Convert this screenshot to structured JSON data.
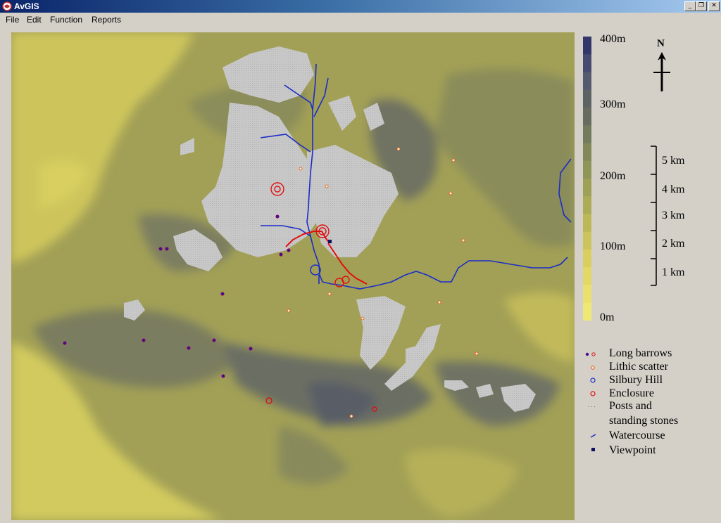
{
  "window": {
    "title": "AvGIS",
    "buttons": {
      "minimize": "_",
      "restore": "❐",
      "close": "✕"
    }
  },
  "menu": {
    "items": [
      "File",
      "Edit",
      "Function",
      "Reports"
    ]
  },
  "elevation_legend": {
    "labels": [
      "400m",
      "300m",
      "200m",
      "100m",
      "0m"
    ],
    "colors": [
      "#33366a",
      "#464a70",
      "#565a6e",
      "#5d6264",
      "#686c60",
      "#747a5c",
      "#82885a",
      "#8f9458",
      "#9ea056",
      "#adac56",
      "#bcb858",
      "#cbc45c",
      "#d8cf60",
      "#e2d865",
      "#eae06b",
      "#f0e874"
    ]
  },
  "north_arrow": {
    "label": "N"
  },
  "scale_bar": {
    "labels": [
      "5 km",
      "4 km",
      "3 km",
      "2 km",
      "1 km"
    ]
  },
  "legend": {
    "items": [
      {
        "label": "Long barrows",
        "symbol": "long-barrows"
      },
      {
        "label": "Lithic scatter",
        "symbol": "lithic-scatter"
      },
      {
        "label": "Silbury Hill",
        "symbol": "silbury-hill"
      },
      {
        "label": "Enclosure",
        "symbol": "enclosure"
      },
      {
        "label": "Posts and",
        "symbol": "posts"
      },
      {
        "label": "standing stones",
        "symbol": ""
      },
      {
        "label": "Watercourse",
        "symbol": "watercourse"
      },
      {
        "label": "Viewpoint",
        "symbol": "viewpoint"
      }
    ]
  },
  "colors": {
    "map_base": "#a2a056",
    "low_ground": "#d4cc5e",
    "high_ground": "#6e7266",
    "visible_area": "#c8c8c8",
    "watercourse": "#1a2cc8",
    "stones": "#e01010",
    "long_barrow": "#4a0a8a",
    "lithic": "#e08030",
    "viewpoint": "#101060"
  }
}
